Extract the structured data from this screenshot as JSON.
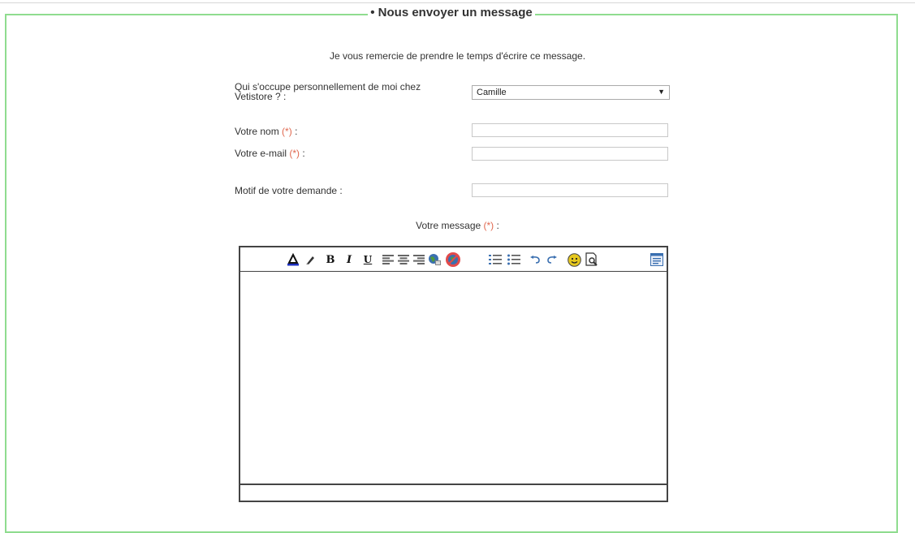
{
  "form": {
    "legend": "• Nous envoyer un message",
    "intro": "Je vous remercie de prendre le temps d'écrire ce message.",
    "required_mark": "(*)",
    "advisor": {
      "label": "Qui s'occupe personnellement de moi chez Vetistore ? :",
      "selected": "Camille"
    },
    "name": {
      "label": "Votre nom",
      "colon": ":",
      "value": ""
    },
    "email": {
      "label": "Votre e-mail",
      "colon": ":",
      "value": ""
    },
    "reason": {
      "label": "Motif de votre demande :",
      "value": ""
    },
    "message": {
      "label": "Votre message",
      "colon": ":"
    }
  },
  "toolbar": {
    "icons": [
      "text-color-icon",
      "highlight-icon",
      "bold-icon",
      "italic-icon",
      "underline-icon",
      "align-left-icon",
      "align-center-icon",
      "align-right-icon",
      "insert-link-icon",
      "remove-link-icon",
      "ordered-list-icon",
      "unordered-list-icon",
      "undo-icon",
      "redo-icon",
      "smiley-icon",
      "preview-icon",
      "source-icon"
    ],
    "bold_glyph": "B",
    "italic_glyph": "I",
    "underline_glyph": "U"
  },
  "colors": {
    "frame": "#8fdc8f",
    "required": "#e0684f"
  }
}
